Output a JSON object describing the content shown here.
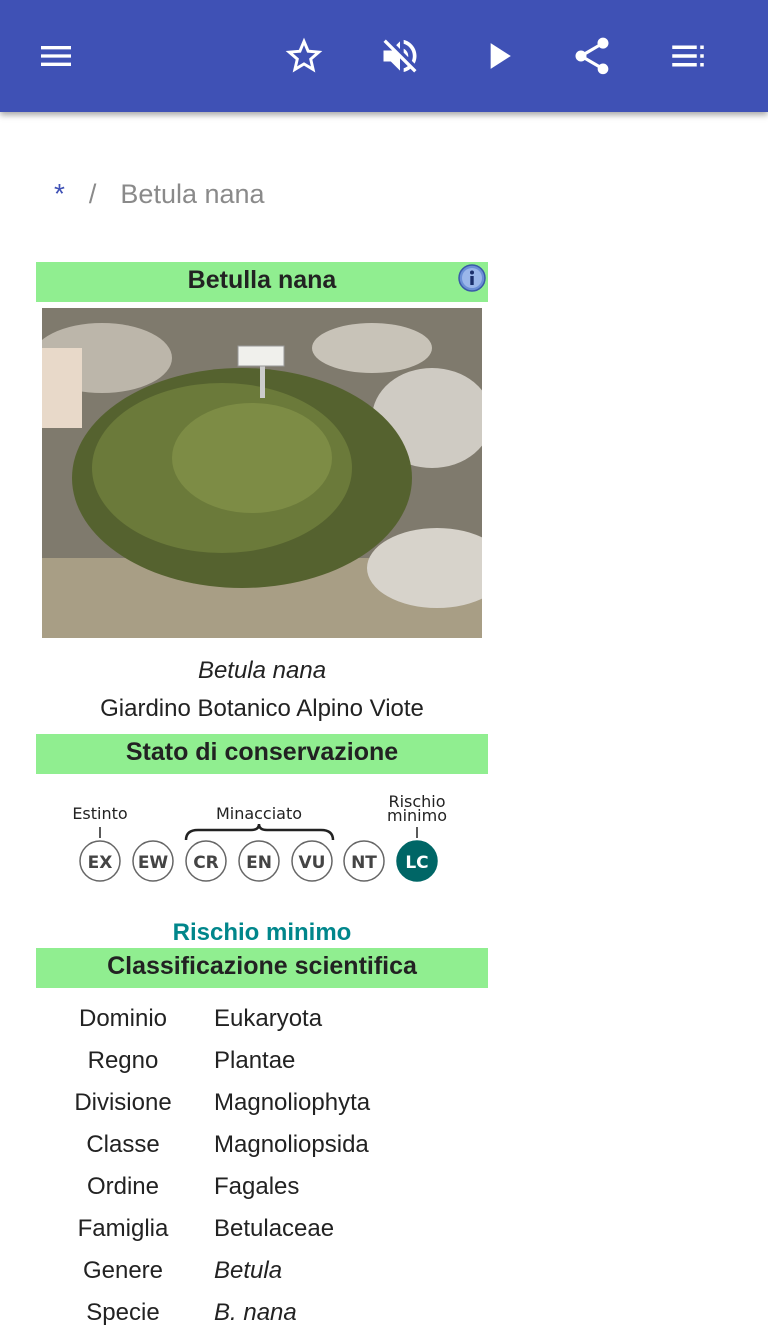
{
  "toolbar": {
    "icons": [
      "menu-icon",
      "star-outline-icon",
      "volume-off-icon",
      "play-icon",
      "share-icon",
      "playlist-icon"
    ]
  },
  "breadcrumb": {
    "home": "*",
    "separator": "/",
    "current": "Betula nana"
  },
  "infobox": {
    "title": "Betulla nana",
    "caption_species": "Betula nana",
    "caption_location": "Giardino Botanico Alpino Viote",
    "conservation_header": "Stato di conservazione",
    "iucn": {
      "label_extinct": "Estinto",
      "label_threatened": "Minacciato",
      "label_least_1": "Rischio",
      "label_least_2": "minimo",
      "categories": [
        "EX",
        "EW",
        "CR",
        "EN",
        "VU",
        "NT",
        "LC"
      ],
      "selected": "LC"
    },
    "status": "Rischio minimo",
    "classification_header": "Classificazione scientifica",
    "taxonomy": [
      {
        "rank": "Dominio",
        "value": "Eukaryota"
      },
      {
        "rank": "Regno",
        "value": "Plantae"
      },
      {
        "rank": "Divisione",
        "value": "Magnoliophyta"
      },
      {
        "rank": "Classe",
        "value": "Magnoliopsida"
      },
      {
        "rank": "Ordine",
        "value": "Fagales"
      },
      {
        "rank": "Famiglia",
        "value": "Betulaceae"
      },
      {
        "rank": "Genere",
        "value": "Betula"
      },
      {
        "rank": "Specie",
        "value": "B. nana"
      }
    ]
  },
  "colors": {
    "appbar": "#3f51b5",
    "header_green": "#90ee90",
    "status_teal": "#00868b",
    "iucn_selected": "#006666"
  }
}
